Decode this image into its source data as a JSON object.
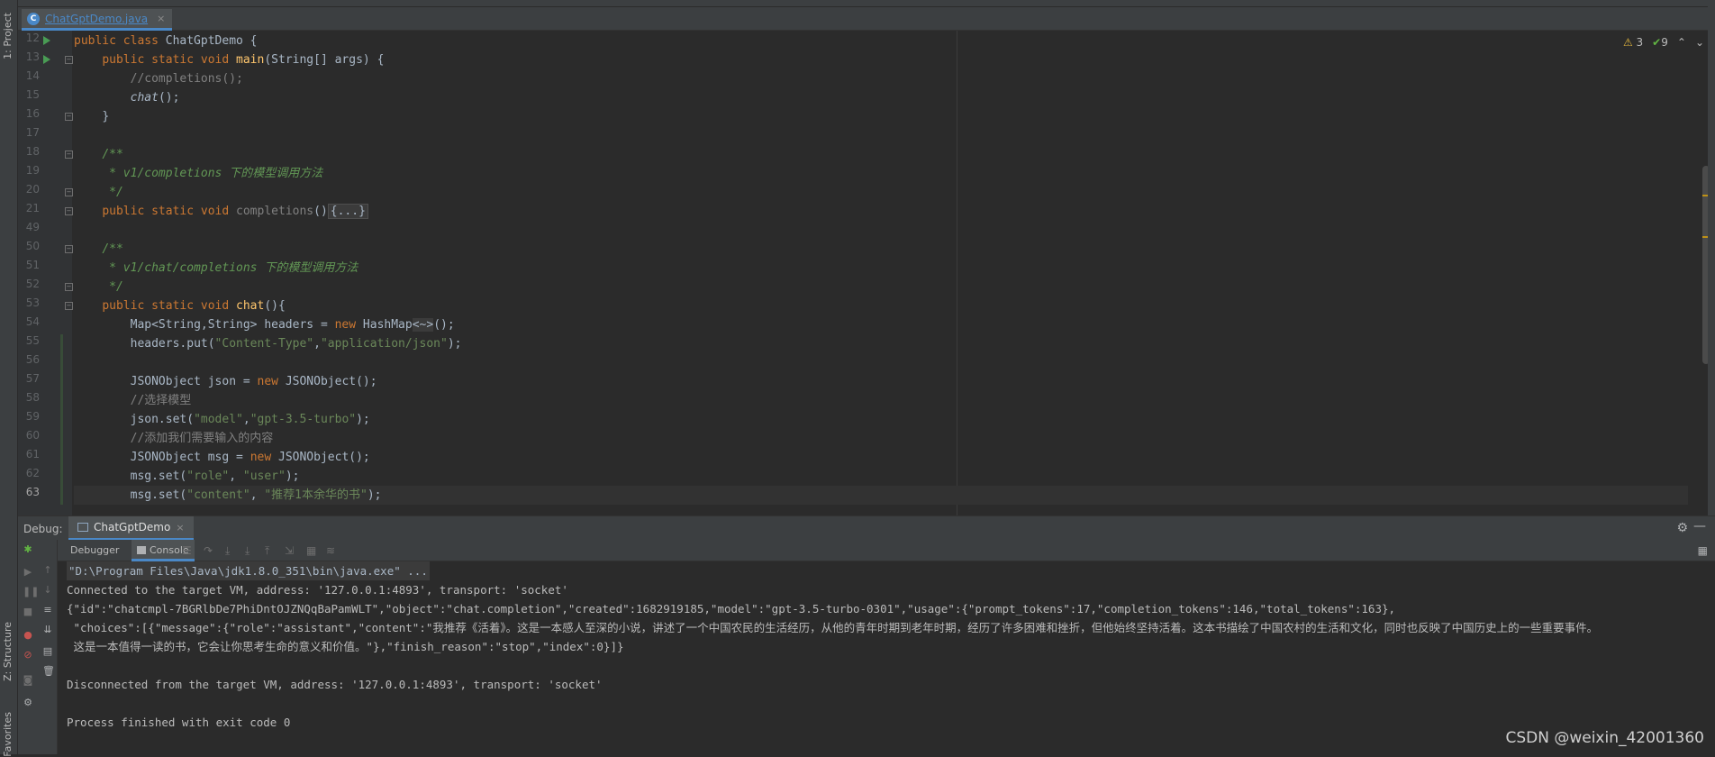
{
  "left_strip": {
    "project_tab": "1: Project",
    "structure_tab": "Z: Structure",
    "favorites_tab": "Favorites"
  },
  "tab": {
    "icon": "java-class-icon",
    "filename": "ChatGptDemo.java",
    "close": "×"
  },
  "inspections": {
    "warnings": "3",
    "ok": "9",
    "warn_icon": "⚠",
    "ok_icon": "✔",
    "up": "⌃",
    "down": "⌄"
  },
  "gutter": {
    "lines": [
      "12",
      "13",
      "14",
      "15",
      "16",
      "17",
      "18",
      "19",
      "20",
      "21",
      "49",
      "50",
      "51",
      "52",
      "53",
      "54",
      "55",
      "56",
      "57",
      "58",
      "59",
      "60",
      "61",
      "62",
      "63"
    ]
  },
  "code": {
    "l12": {
      "kw1": "public class ",
      "name": "ChatGptDemo",
      "rest": " {"
    },
    "l13": {
      "kw1": "public static void ",
      "fn": "main",
      "rest": "(String[] args) {"
    },
    "l14": {
      "cmt": "//completions();"
    },
    "l15": {
      "fn": "chat",
      "rest": "();"
    },
    "l16": {
      "rest": "}"
    },
    "l18": {
      "doc": "/**"
    },
    "l19": {
      "doc": " * v1/completions 下的模型调用方法"
    },
    "l20": {
      "doc": " */"
    },
    "l21": {
      "kw1": "public static void ",
      "name": "completions",
      "rest": "()",
      "fold": "{...}"
    },
    "l50": {
      "doc": "/**"
    },
    "l51": {
      "doc": " * v1/chat/completions 下的模型调用方法"
    },
    "l52": {
      "doc": " */"
    },
    "l53": {
      "kw1": "public static void ",
      "fn": "chat",
      "rest": "(){"
    },
    "l54": {
      "pre": "Map<String,String> headers = ",
      "kw": "new ",
      "cls": "HashMap",
      "dia": "<~>",
      "rest": "();"
    },
    "l55": {
      "pre": "headers.put(",
      "s1": "\"Content-Type\"",
      "mid": ",",
      "s2": "\"application/json\"",
      "rest": ");"
    },
    "l57": {
      "pre": "JSONObject json = ",
      "kw": "new ",
      "rest": "JSONObject();"
    },
    "l58": {
      "cmt": "//选择模型"
    },
    "l59": {
      "pre": "json.set(",
      "s1": "\"model\"",
      "mid": ",",
      "s2": "\"gpt-3.5-turbo\"",
      "rest": ");"
    },
    "l60": {
      "cmt": "//添加我们需要输入的内容"
    },
    "l61": {
      "pre": "JSONObject msg = ",
      "kw": "new ",
      "rest": "JSONObject();"
    },
    "l62": {
      "pre": "msg.set(",
      "s1": "\"role\"",
      "mid": ", ",
      "s2": "\"user\"",
      "rest": ");"
    },
    "l63": {
      "pre": "msg.set(",
      "s1": "\"content\"",
      "mid": ", ",
      "s2": "\"推荐1本余华的书\"",
      "rest": ");"
    }
  },
  "debug": {
    "title": "Debug:",
    "run_name": "ChatGptDemo",
    "close": "×",
    "tabs": {
      "debugger": "Debugger",
      "console": "Console"
    },
    "gear": "⚙",
    "minimize": "—"
  },
  "console": {
    "l1": "\"D:\\Program Files\\Java\\jdk1.8.0_351\\bin\\java.exe\" ...",
    "l2": "Connected to the target VM, address: '127.0.0.1:4893', transport: 'socket'",
    "l3": "{\"id\":\"chatcmpl-7BGRlbDe7PhiDntOJZNQqBaPamWLT\",\"object\":\"chat.completion\",\"created\":1682919185,\"model\":\"gpt-3.5-turbo-0301\",\"usage\":{\"prompt_tokens\":17,\"completion_tokens\":146,\"total_tokens\":163},",
    "l4": " \"choices\":[{\"message\":{\"role\":\"assistant\",\"content\":\"我推荐《活着》。这是一本感人至深的小说，讲述了一个中国农民的生活经历，从他的青年时期到老年时期，经历了许多困难和挫折，但他始终坚持活着。这本书描绘了中国农村的生活和文化，同时也反映了中国历史上的一些重要事件。",
    "l5": " 这是一本值得一读的书，它会让你思考生命的意义和价值。\"},\"finish_reason\":\"stop\",\"index\":0}]}",
    "l6": "Disconnected from the target VM, address: '127.0.0.1:4893', transport: 'socket'",
    "l7": "Process finished with exit code 0"
  },
  "watermark": "CSDN @weixin_42001360"
}
